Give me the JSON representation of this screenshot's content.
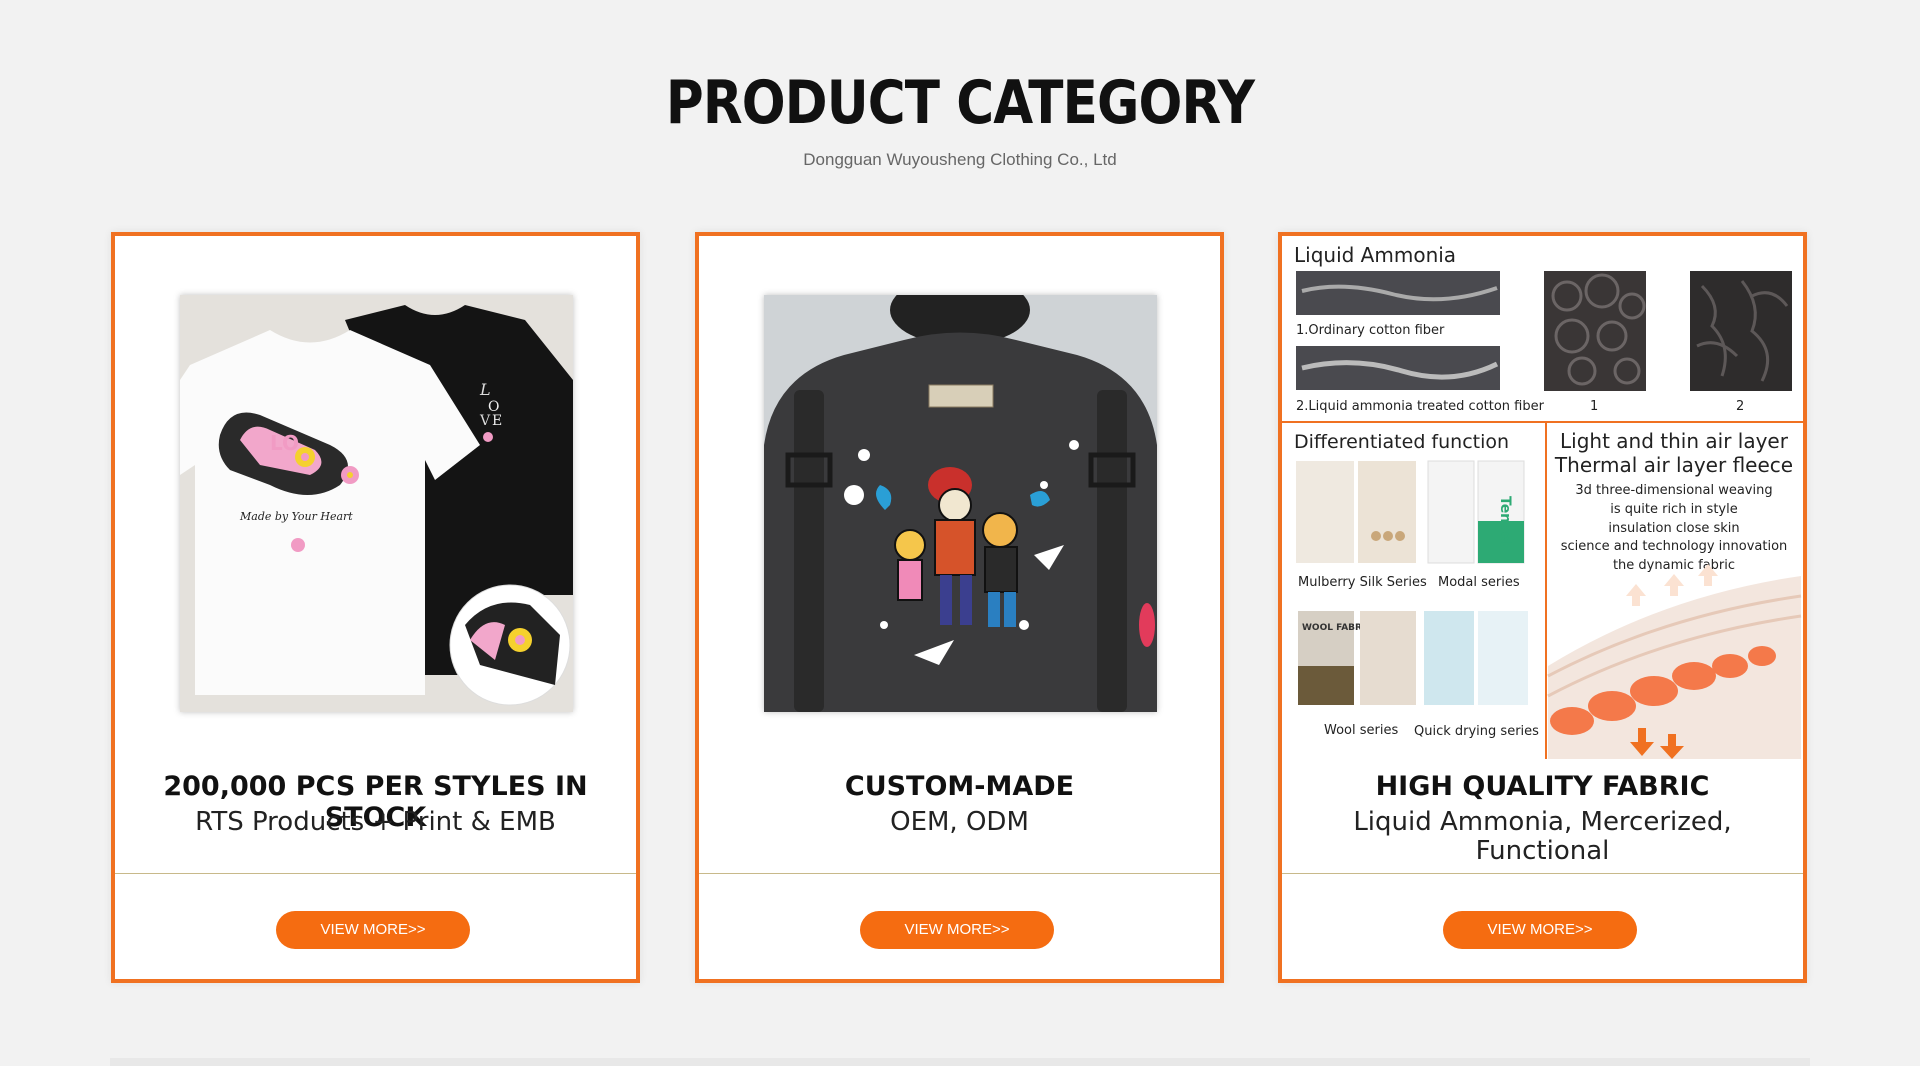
{
  "header": {
    "title": "PRODUCT CATEGORY",
    "subtitle": "Dongguan Wuyousheng Clothing Co., Ltd"
  },
  "cards": [
    {
      "heading": "200,000 PCS PER STYLES IN STOCK",
      "sub": "RTS Products + Print & EMB",
      "button": "VIEW MORE>>",
      "image_labels": {
        "tee_text": "Made by Your Heart",
        "love": "LOVE"
      }
    },
    {
      "heading": "CUSTOM-MADE",
      "sub": "OEM, ODM",
      "button": "VIEW MORE>>"
    },
    {
      "heading": "HIGH QUALITY FABRIC",
      "sub": "Liquid Ammonia, Mercerized, Functional",
      "button": "VIEW MORE>>",
      "fabric": {
        "liquid_title": "Liquid Ammonia",
        "fiber1": "1.Ordinary cotton fiber",
        "fiber2": "2.Liquid ammonia treated cotton fiber",
        "n1": "1",
        "n2": "2",
        "diff_title": "Differentiated function",
        "mulberry": "Mulberry Silk Series",
        "modal": "Modal series",
        "wool": "Wool series",
        "quick": "Quick drying series",
        "tencel": "Tencel",
        "wool_tag": "WOOL FABRIC",
        "air_title1": "Light and thin air layer",
        "air_title2": "Thermal air layer fleece",
        "air1": "3d three-dimensional weaving",
        "air2": "is quite rich in style",
        "air3": "insulation close skin",
        "air4": "science and technology innovation",
        "air5": "the dynamic fabric"
      }
    }
  ],
  "colors": {
    "accent": "#f56c11",
    "border": "#f07121",
    "background": "#f2f2f2"
  }
}
